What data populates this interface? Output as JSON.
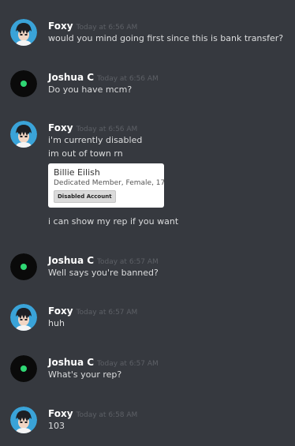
{
  "users": {
    "foxy": "Foxy",
    "joshua": "Joshua C"
  },
  "messages": [
    {
      "author": "Foxy",
      "time": "Today at 6:56 AM",
      "lines": [
        "would you mind going first since this is bank transfer?"
      ]
    },
    {
      "author": "Joshua C",
      "time": "Today at 6:56 AM",
      "lines": [
        "Do you have mcm?"
      ]
    },
    {
      "author": "Foxy",
      "time": "Today at 6:56 AM",
      "lines": [
        "i'm currently disabled",
        "im out of town rn"
      ],
      "card": {
        "name": "Billie Eilish",
        "subtitle": "Dedicated Member, Female, 17",
        "badge": "Disabled Account"
      },
      "after": "i can show my rep if you want"
    },
    {
      "author": "Joshua C",
      "time": "Today at 6:57 AM",
      "lines": [
        "Well says you're banned?"
      ]
    },
    {
      "author": "Foxy",
      "time": "Today at 6:57 AM",
      "lines": [
        "huh"
      ]
    },
    {
      "author": "Joshua C",
      "time": "Today at 6:57 AM",
      "lines": [
        "What's your rep?"
      ]
    },
    {
      "author": "Foxy",
      "time": "Today at 6:58 AM",
      "lines": [
        "103"
      ]
    }
  ],
  "colors": {
    "background": "#36393f",
    "username": "#ffffff",
    "timestamp": "#5d6066",
    "message_text": "#dcddde",
    "foxy_avatar_bg": "#3aa3d8",
    "joshua_avatar_bg": "#0a0a0a",
    "joshua_avatar_dot": "#2fd774"
  },
  "icons": {
    "foxy_avatar": "anime-character-avatar",
    "joshua_avatar": "green-dot-avatar"
  }
}
